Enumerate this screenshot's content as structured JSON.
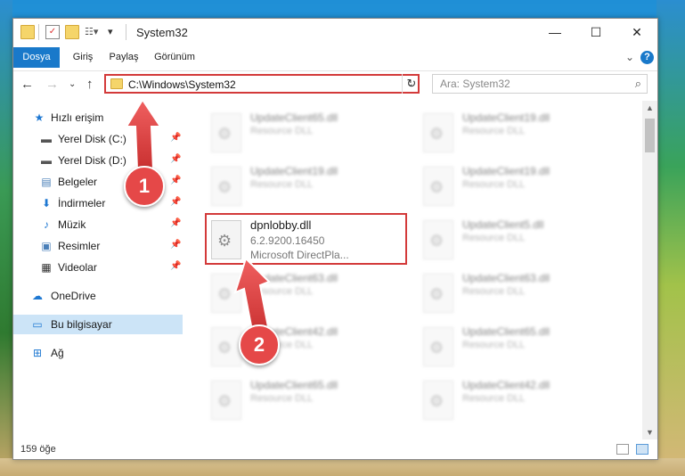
{
  "window": {
    "title": "System32"
  },
  "ribbon": {
    "tabs": [
      "Dosya",
      "Giriş",
      "Paylaş",
      "Görünüm"
    ]
  },
  "nav": {
    "address": "C:\\Windows\\System32",
    "search_placeholder": "Ara: System32"
  },
  "sidebar": {
    "items": [
      {
        "label": "Hızlı erişim",
        "icon": "star-icon"
      },
      {
        "label": "Yerel Disk (C:)",
        "icon": "drive-icon",
        "pinned": true
      },
      {
        "label": "Yerel Disk (D:)",
        "icon": "drive-icon",
        "pinned": true
      },
      {
        "label": "Belgeler",
        "icon": "documents-icon",
        "pinned": true
      },
      {
        "label": "İndirmeler",
        "icon": "download-icon",
        "pinned": true
      },
      {
        "label": "Müzik",
        "icon": "music-icon",
        "pinned": true
      },
      {
        "label": "Resimler",
        "icon": "pictures-icon",
        "pinned": true
      },
      {
        "label": "Videolar",
        "icon": "videos-icon",
        "pinned": true
      },
      {
        "label": "OneDrive",
        "icon": "cloud-icon"
      },
      {
        "label": "Bu bilgisayar",
        "icon": "computer-icon",
        "selected": true
      },
      {
        "label": "Ağ",
        "icon": "network-icon"
      }
    ]
  },
  "files": [
    {
      "name": "UpdateClient65.dll",
      "sub1": "Resource DLL"
    },
    {
      "name": "UpdateClient19.dll",
      "sub1": "Resource DLL"
    },
    {
      "name": "UpdateClient19.dll",
      "sub1": "Resource DLL"
    },
    {
      "name": "UpdateClient19.dll",
      "sub1": "Resource DLL"
    },
    {
      "name": "dpnlobby.dll",
      "sub1": "6.2.9200.16450",
      "sub2": "Microsoft DirectPla..."
    },
    {
      "name": "UpdateClient5.dll",
      "sub1": "Resource DLL"
    },
    {
      "name": "UpdateClient63.dll",
      "sub1": "Resource DLL"
    },
    {
      "name": "UpdateClient63.dll",
      "sub1": "Resource DLL"
    },
    {
      "name": "UpdateClient42.dll",
      "sub1": "Resource DLL"
    },
    {
      "name": "UpdateClient65.dll",
      "sub1": "Resource DLL"
    },
    {
      "name": "UpdateClient65.dll",
      "sub1": "Resource DLL"
    },
    {
      "name": "UpdateClient42.dll",
      "sub1": "Resource DLL"
    }
  ],
  "status": {
    "count": "159 öğe"
  },
  "annotations": {
    "badge1": "1",
    "badge2": "2"
  },
  "colors": {
    "accent": "#1979ca",
    "highlight": "#d33a3a",
    "badge": "#e54848"
  }
}
